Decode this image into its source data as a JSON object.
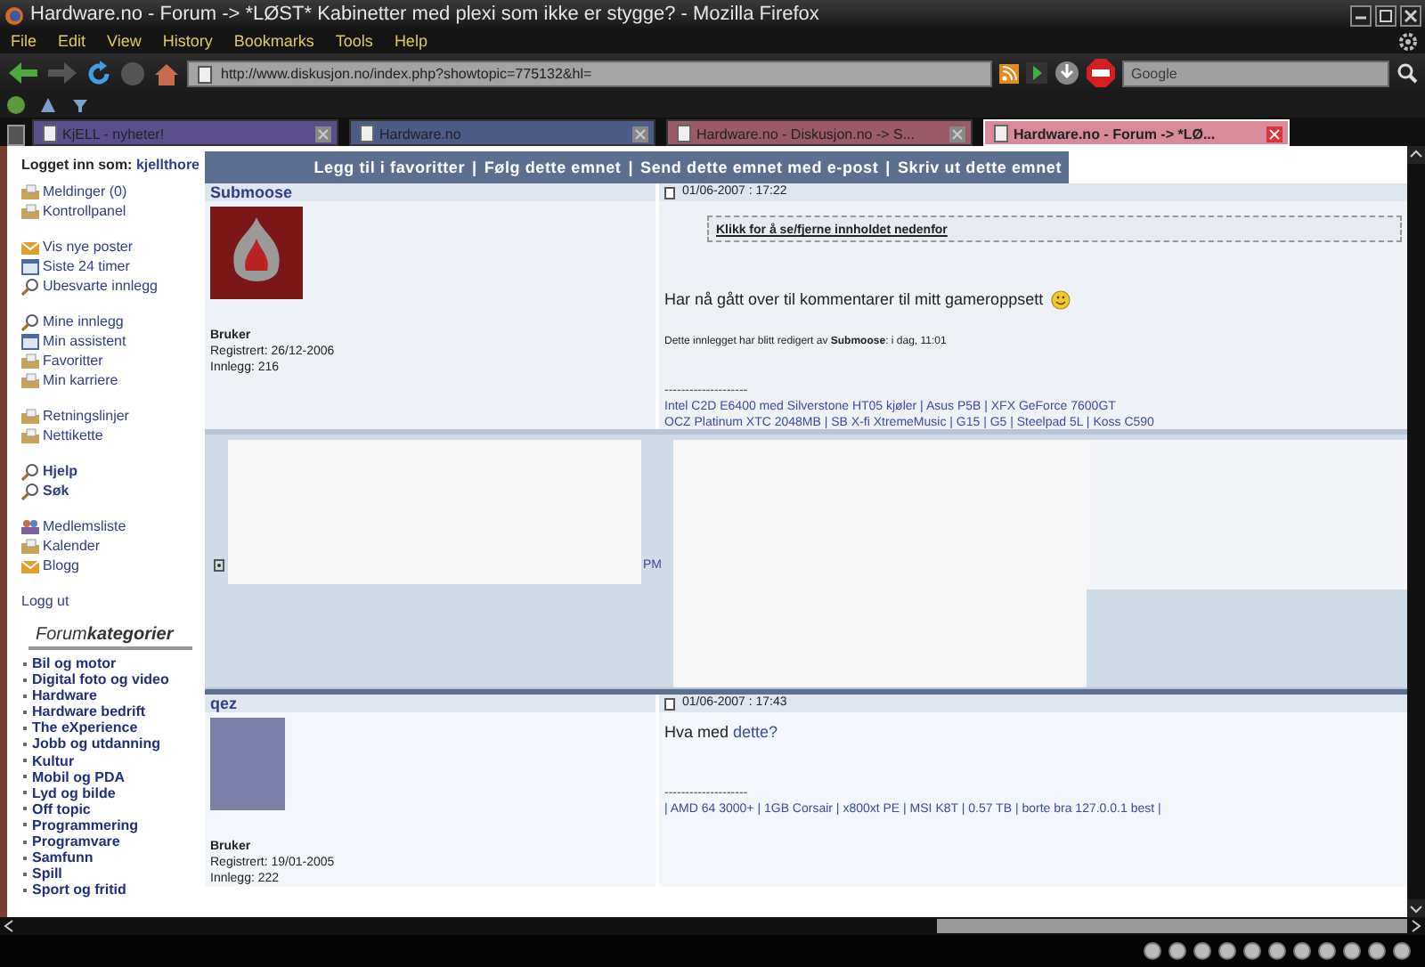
{
  "window": {
    "title": "Hardware.no - Forum -> *LØST* Kabinetter med plexi som ikke er stygge? - Mozilla Firefox"
  },
  "menu": [
    "File",
    "Edit",
    "View",
    "History",
    "Bookmarks",
    "Tools",
    "Help"
  ],
  "address_bar": {
    "url": "http://www.diskusjon.no/index.php?showtopic=775132&hl="
  },
  "search": {
    "placeholder": "Google"
  },
  "tabs": [
    {
      "label": "KjELL - nyheter!",
      "selected": false,
      "color": "#5a4f8c"
    },
    {
      "label": "Hardware.no",
      "selected": false,
      "color": "#4b5c86"
    },
    {
      "label": "Hardware.no - Diskusjon.no -> S...",
      "selected": false,
      "color": "#9a5a68"
    },
    {
      "label": "Hardware.no - Forum -> *LØ...",
      "selected": true,
      "color": "#d98a98"
    }
  ],
  "sidebar": {
    "login_label": "Logget inn som:",
    "login_user": "kjellthore",
    "groups": [
      [
        {
          "label": "Meldinger (0)",
          "kind": "folder",
          "bold": false
        },
        {
          "label": "Kontrollpanel",
          "kind": "folder",
          "bold": false
        }
      ],
      [
        {
          "label": "Vis nye poster",
          "kind": "envelope",
          "bold": false
        },
        {
          "label": "Siste 24 timer",
          "kind": "calendar",
          "bold": false
        },
        {
          "label": "Ubesvarte innlegg",
          "kind": "search",
          "bold": false
        }
      ],
      [
        {
          "label": "Mine innlegg",
          "kind": "search",
          "bold": false
        },
        {
          "label": "Min assistent",
          "kind": "calendar",
          "bold": false
        },
        {
          "label": "Favoritter",
          "kind": "folder",
          "bold": false
        },
        {
          "label": "Min karriere",
          "kind": "folder",
          "bold": false
        }
      ],
      [
        {
          "label": "Retningslinjer",
          "kind": "folder",
          "bold": false
        },
        {
          "label": "Nettikette",
          "kind": "folder",
          "bold": false
        }
      ],
      [
        {
          "label": "Hjelp",
          "kind": "search",
          "bold": true
        },
        {
          "label": "Søk",
          "kind": "search",
          "bold": true
        }
      ],
      [
        {
          "label": "Medlemsliste",
          "kind": "people",
          "bold": false
        },
        {
          "label": "Kalender",
          "kind": "folder",
          "bold": false
        },
        {
          "label": "Blogg",
          "kind": "envelope",
          "bold": false
        }
      ]
    ],
    "logout": "Logg ut",
    "categories_title": "Forum**kategorier**",
    "categories": [
      "Bil og motor",
      "Digital foto og video",
      "Hardware",
      "Hardware bedrift",
      "The eXperience",
      "Jobb og utdanning",
      "Kultur",
      "Mobil og PDA",
      "Lyd og bilde",
      "Off topic",
      "Programmering",
      "Programvare",
      "Samfunn",
      "Spill",
      "Sport og fritid"
    ]
  },
  "topic_actions_separator": "|",
  "topic_actions": [
    "Legg til i favoritter",
    "Følg dette emnet",
    "Send dette emnet med e-post",
    "Skriv ut dette emnet"
  ],
  "posts": [
    {
      "author": "Submoose",
      "avatar": {
        "kind": "logo"
      },
      "role": "Bruker",
      "registered": "Registrert: 26/12-2006",
      "post_count": "Innlegg: 216",
      "date": "01/06-2007 : 17:22",
      "spoiler": "Klikk for å se/fjerne innholdet nedenfor",
      "text": "Har nå gått over til kommentarer til mitt gameroppsett",
      "smiley": true,
      "edited_note": "Dette innlegget har blitt redigert av **Submoose**: i dag, 11:01",
      "signature_rule": "--------------------",
      "signature_lines": [
        "Intel C2D E6400 med Silverstone HT05 kjøler | Asus P5B | XFX GeForce 7600GT",
        "OCZ Platinum XTC 2048MB | SB X-fi XtremeMusic | G15 | G5 | Steelpad 5L | Koss C590"
      ]
    },
    {
      "author": "qez",
      "avatar": {
        "kind": "photo"
      },
      "role": "Bruker",
      "registered": "Registrert: 19/01-2005",
      "post_count": "Innlegg: 222",
      "date": "01/06-2007 : 17:43",
      "text": "Hva med",
      "link": "dette?",
      "smiley": false,
      "signature_rule": "--------------------",
      "signature_lines": [
        "| AMD 64 3000+ | 1GB Corsair | x800xt PE | MSI K8T | 0.57 TB | borte bra 127.0.0.1 best |"
      ]
    }
  ],
  "post_footer": {
    "label": "PM"
  }
}
